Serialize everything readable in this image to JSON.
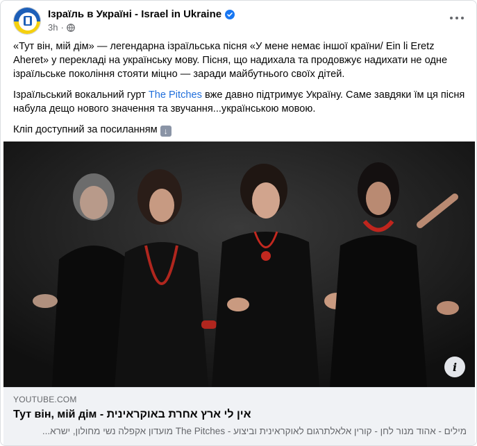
{
  "post": {
    "author": "Ізраїль в Україні - Israel in Ukraine",
    "time": "3h",
    "separator": "·",
    "paragraphs": {
      "p1": "«Тут він, мій дім» — легендарна ізраїльська пісня «У мене немає іншої країни/ Ein li Eretz Aheret» у перекладі на українську мову. Пісня, що надихала та продовжує надихати не одне ізраїльське покоління стояти міцно — заради майбутнього своїх дітей.",
      "p2_before": "Ізраїльський вокальний гурт ",
      "p2_link": "The Pitches",
      "p2_after": " вже давно підтримує Україну. Саме завдяки їм ця пісня набула дещо нового значення та звучання...українською мовою.",
      "p3": "Кліп доступний за посиланням"
    },
    "icons": {
      "verified": "verified-badge-icon",
      "privacy": "globe-icon",
      "more": "more-options-icon",
      "emoji": "down-arrow-emoji",
      "info": "info-icon"
    },
    "colors": {
      "link": "#216fdb",
      "verified": "#1877f2",
      "preview_bg": "#f0f2f5"
    }
  },
  "preview": {
    "domain": "YOUTUBE.COM",
    "title": "Тут він, мій дім - אין לי ארץ אחרת באוקראינית",
    "description": "מילים - אהוד מנור לחן - קורין אלאלתרגום לאוקראינית וביצוע - The Pitches מועדון אקפלה נשי מחולון, ישרא..."
  },
  "media": {
    "info_label": "i"
  }
}
